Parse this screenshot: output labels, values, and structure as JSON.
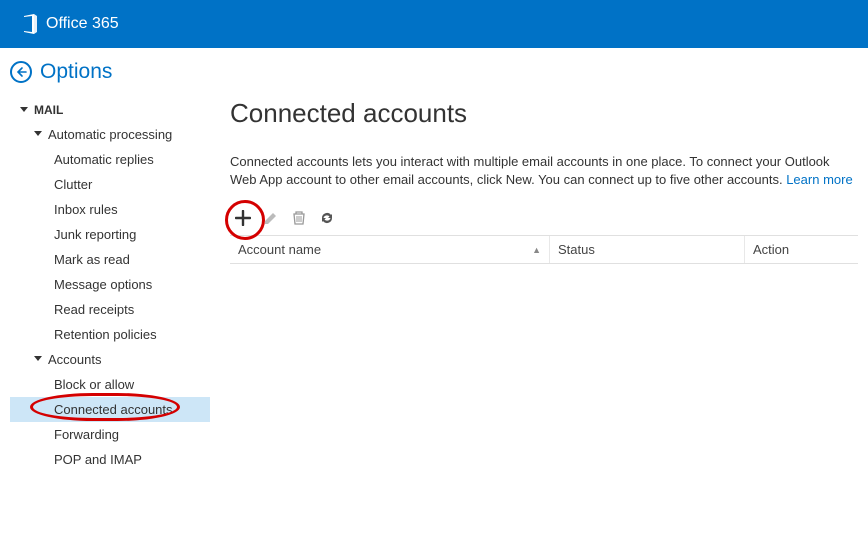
{
  "header": {
    "brand": "Office 365"
  },
  "options": {
    "label": "Options"
  },
  "sidebar": {
    "root": "MAIL",
    "group1": {
      "label": "Automatic processing",
      "items": [
        "Automatic replies",
        "Clutter",
        "Inbox rules",
        "Junk reporting",
        "Mark as read",
        "Message options",
        "Read receipts",
        "Retention policies"
      ]
    },
    "group2": {
      "label": "Accounts",
      "items": [
        "Block or allow",
        "Connected accounts",
        "Forwarding",
        "POP and IMAP"
      ]
    }
  },
  "page": {
    "title": "Connected accounts",
    "description": "Connected accounts lets you interact with multiple email accounts in one place. To connect your Outlook Web App account to other email accounts, click New. You can connect up to five other accounts. ",
    "learn_more": "Learn more"
  },
  "toolbar": {
    "new": "New",
    "edit": "Edit",
    "delete": "Delete",
    "refresh": "Refresh"
  },
  "table": {
    "columns": {
      "name": "Account name",
      "status": "Status",
      "action": "Action"
    }
  }
}
